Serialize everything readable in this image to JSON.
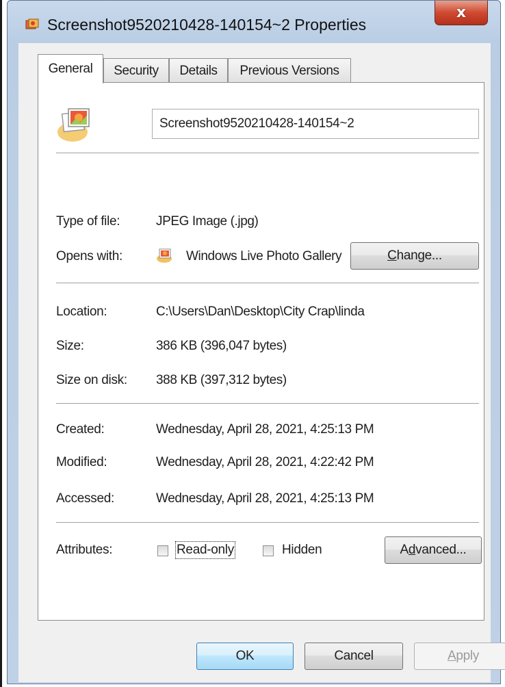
{
  "window": {
    "title": "Screenshot9520210428-140154~2 Properties",
    "close_glyph": "x"
  },
  "tabs": [
    {
      "label": "General",
      "active": true
    },
    {
      "label": "Security",
      "active": false
    },
    {
      "label": "Details",
      "active": false
    },
    {
      "label": "Previous Versions",
      "active": false
    }
  ],
  "general": {
    "file_name": "Screenshot9520210428-140154~2",
    "type_label": "Type of file:",
    "type_value": "JPEG Image (.jpg)",
    "opens_label": "Opens with:",
    "opens_value": "Windows Live Photo Gallery",
    "change_button": {
      "before": "",
      "accel": "C",
      "after": "hange..."
    },
    "location_label": "Location:",
    "location_value": "C:\\Users\\Dan\\Desktop\\City Crap\\linda",
    "size_label": "Size:",
    "size_value": "386 KB (396,047 bytes)",
    "size_on_disk_label": "Size on disk:",
    "size_on_disk_value": "388 KB (397,312 bytes)",
    "created_label": "Created:",
    "created_value": "Wednesday, April 28, 2021, 4:25:13 PM",
    "modified_label": "Modified:",
    "modified_value": "Wednesday, April 28, 2021, 4:22:42 PM",
    "accessed_label": "Accessed:",
    "accessed_value": "Wednesday, April 28, 2021, 4:25:13 PM",
    "attributes_label": "Attributes:",
    "readonly": {
      "accel": "R",
      "rest": "ead-only",
      "checked": false
    },
    "hidden": {
      "accel": "H",
      "rest": "idden",
      "checked": false
    },
    "advanced_button": {
      "before": "A",
      "accel": "d",
      "after": "vanced..."
    }
  },
  "footer": {
    "ok": "OK",
    "cancel": "Cancel",
    "apply": {
      "accel": "A",
      "rest": "pply"
    }
  },
  "colors": {
    "window_frame": "#bfd1e6",
    "close_button": "#cf4a30",
    "default_button_border": "#3c7fb1",
    "disabled_text": "#9b9b9b"
  },
  "icons": {
    "title": "jpeg-file-icon",
    "file": "jpeg-file-large-icon",
    "app": "photo-gallery-icon"
  }
}
